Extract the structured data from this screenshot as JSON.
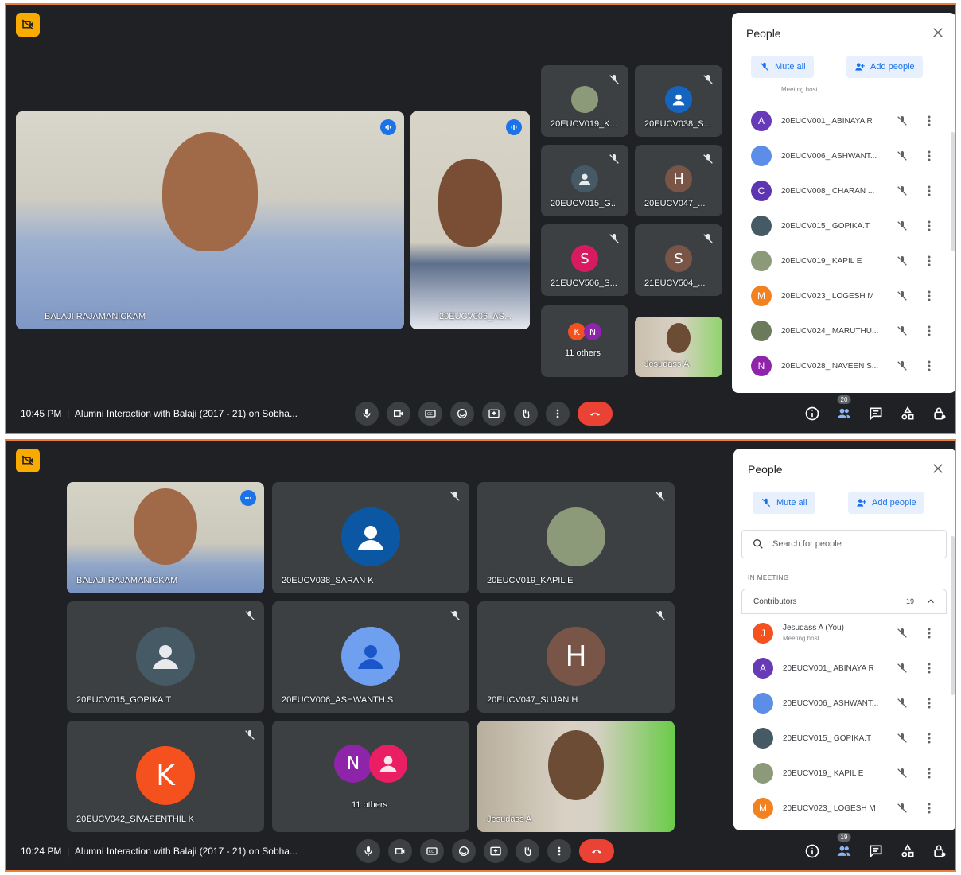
{
  "meeting1": {
    "time": "10:45 PM",
    "title": "Alumni Interaction with Balaji (2017 - 21) on Sobha...",
    "participant_count": "20",
    "tiles": {
      "main1": "BALAJI RAJAMANICKAM",
      "main2": "20EUCV006_AS...",
      "s1": "20EUCV019_K...",
      "s2": "20EUCV038_S...",
      "s3": "20EUCV015_G...",
      "s4": "20EUCV047_...",
      "s5": "21EUCV506_S...",
      "s6": "21EUCV504_...",
      "others": "11 others",
      "self": "Jesudass A"
    },
    "avatar_letters": {
      "s4": "H",
      "s5": "S",
      "s6": "S",
      "k": "K",
      "n": "N"
    },
    "people_panel": {
      "title": "People",
      "mute_all": "Mute all",
      "add_people": "Add people",
      "truncated_top": "Meeting host",
      "rows": [
        {
          "letter": "A",
          "name": "20EUCV001_ ABINAYA R",
          "color": "#673ab7"
        },
        {
          "letter": "",
          "name": "20EUCV006_ ASHWANT...",
          "color": "#5c8ee8"
        },
        {
          "letter": "C",
          "name": "20EUCV008_ CHARAN ...",
          "color": "#5e35b1"
        },
        {
          "letter": "",
          "name": "20EUCV015_ GOPIKA.T",
          "color": "#455a64"
        },
        {
          "letter": "",
          "name": "20EUCV019_ KAPIL E",
          "color": "#8d9a7a"
        },
        {
          "letter": "M",
          "name": "20EUCV023_ LOGESH M",
          "color": "#f4811f"
        },
        {
          "letter": "",
          "name": "20EUCV024_ MARUTHU...",
          "color": "#6b7a5a"
        },
        {
          "letter": "N",
          "name": "20EUCV028_ NAVEEN S...",
          "color": "#8e24aa"
        }
      ]
    }
  },
  "meeting2": {
    "time": "10:24 PM",
    "title": "Alumni Interaction with Balaji (2017 - 21) on Sobha...",
    "participant_count": "19",
    "tiles": {
      "t1": "BALAJI RAJAMANICKAM",
      "t2": "20EUCV038_SARAN K",
      "t3": "20EUCV019_KAPIL E",
      "t4": "20EUCV015_GOPIKA.T",
      "t5": "20EUCV006_ASHWANTH S",
      "t6": "20EUCV047_SUJAN H",
      "t7": "20EUCV042_SIVASENTHIL K",
      "t8": "11 others",
      "t9": "Jesudass A"
    },
    "avatar_letters": {
      "t6": "H",
      "t7": "K",
      "n": "N"
    },
    "people_panel": {
      "title": "People",
      "mute_all": "Mute all",
      "add_people": "Add people",
      "search_placeholder": "Search for people",
      "section": "IN MEETING",
      "group": "Contributors",
      "group_count": "19",
      "rows": [
        {
          "letter": "J",
          "name": "Jesudass A (You)",
          "sub": "Meeting host",
          "color": "#f4511e"
        },
        {
          "letter": "A",
          "name": "20EUCV001_ ABINAYA R",
          "sub": "",
          "color": "#673ab7"
        },
        {
          "letter": "",
          "name": "20EUCV006_ ASHWANT...",
          "sub": "",
          "color": "#5c8ee8"
        },
        {
          "letter": "",
          "name": "20EUCV015_ GOPIKA.T",
          "sub": "",
          "color": "#455a64"
        },
        {
          "letter": "",
          "name": "20EUCV019_ KAPIL E",
          "sub": "",
          "color": "#8d9a7a"
        },
        {
          "letter": "M",
          "name": "20EUCV023_ LOGESH M",
          "sub": "",
          "color": "#f4811f"
        }
      ]
    }
  },
  "icons": [
    "camera-off-icon",
    "mic-off-icon",
    "speaking-icon",
    "mic-icon",
    "camera-icon",
    "captions-icon",
    "emoji-icon",
    "present-icon",
    "raise-hand-icon",
    "more-icon",
    "end-call-icon",
    "info-icon",
    "people-icon",
    "chat-icon",
    "activities-icon",
    "host-controls-icon",
    "close-icon",
    "search-icon",
    "chevron-up-icon"
  ]
}
